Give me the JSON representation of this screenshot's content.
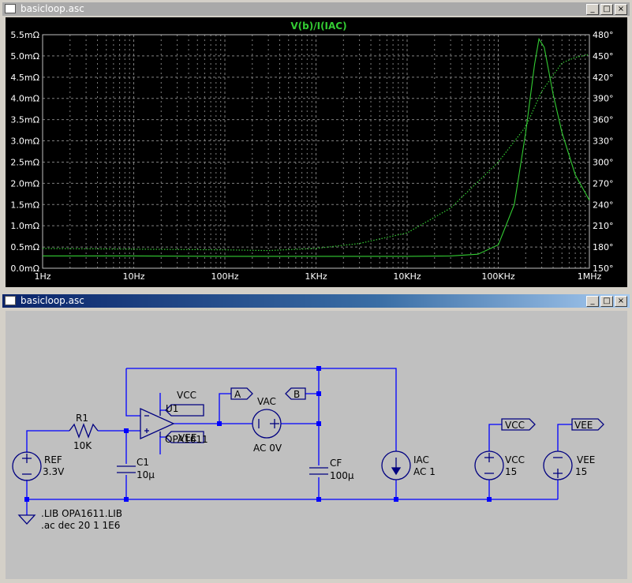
{
  "plot_window": {
    "title": "basicloop.asc",
    "buttons": {
      "minimize": "_",
      "maximize": "□",
      "close": "×"
    }
  },
  "schematic_window": {
    "title": "basicloop.asc",
    "buttons": {
      "minimize": "_",
      "maximize": "□",
      "close": "×"
    }
  },
  "colors": {
    "trace": "#33cc33",
    "grid": "#7f7f7f",
    "wire": "#0000ff",
    "component": "#000080",
    "plot_bg": "#000000",
    "schematic_bg": "#c0c0c0",
    "active_title": "#0a246a",
    "inactive_title": "#a9a9a9"
  },
  "chart_data": {
    "type": "line",
    "title": "V(b)/I(IAC)",
    "x_scale": "log",
    "x_ticks": [
      "1Hz",
      "10Hz",
      "100Hz",
      "1KHz",
      "10KHz",
      "100KHz",
      "1MHz"
    ],
    "xlim": [
      1,
      1000000
    ],
    "y_left_ticks": [
      "0.0mΩ",
      "0.5mΩ",
      "1.0mΩ",
      "1.5mΩ",
      "2.0mΩ",
      "2.5mΩ",
      "3.0mΩ",
      "3.5mΩ",
      "4.0mΩ",
      "4.5mΩ",
      "5.0mΩ",
      "5.5mΩ"
    ],
    "ylim_left": [
      0,
      5.5
    ],
    "y_right_ticks": [
      "150°",
      "180°",
      "210°",
      "240°",
      "270°",
      "300°",
      "330°",
      "360°",
      "390°",
      "420°",
      "450°",
      "480°"
    ],
    "ylim_right": [
      150,
      480
    ],
    "grid": true,
    "series": [
      {
        "axis": "left",
        "style": "solid",
        "x": [
          1,
          10,
          100,
          1000,
          10000,
          30000,
          60000,
          100000,
          150000,
          200000,
          250000,
          280000,
          320000,
          400000,
          500000,
          700000,
          1000000
        ],
        "y": [
          0.29,
          0.29,
          0.28,
          0.28,
          0.28,
          0.29,
          0.33,
          0.55,
          1.5,
          3.2,
          4.8,
          5.4,
          5.2,
          4.1,
          3.2,
          2.2,
          1.6
        ]
      },
      {
        "axis": "right",
        "style": "dotted",
        "x": [
          1,
          10,
          100,
          300,
          1000,
          3000,
          10000,
          30000,
          100000,
          200000,
          300000,
          500000,
          700000,
          1000000
        ],
        "y": [
          178,
          177,
          176,
          175,
          178,
          185,
          200,
          235,
          300,
          350,
          400,
          440,
          448,
          452
        ]
      }
    ]
  },
  "schematic": {
    "components": {
      "r1": {
        "ref": "R1",
        "value": "10K"
      },
      "ref_source": {
        "ref": "REF",
        "value": "3.3V"
      },
      "c1": {
        "ref": "C1",
        "value": "10µ"
      },
      "opamp": {
        "ref": "U1",
        "value": "OPA1611"
      },
      "vac": {
        "ref": "VAC",
        "value": "AC 0V"
      },
      "cf": {
        "ref": "CF",
        "value": "100µ"
      },
      "iac": {
        "ref": "IAC",
        "value": "AC 1"
      },
      "vcc_source": {
        "ref": "VCC",
        "value": "15"
      },
      "vee_source": {
        "ref": "VEE",
        "value": "15"
      }
    },
    "net_labels": {
      "a": "A",
      "b": "B",
      "vcc_opamp": "VCC",
      "vee_opamp": "VEE",
      "vcc_supply": "VCC",
      "vee_supply": "VEE"
    },
    "directives": {
      "lib": ".LIB OPA1611.LIB",
      "ac": ".ac dec 20 1 1E6"
    }
  }
}
